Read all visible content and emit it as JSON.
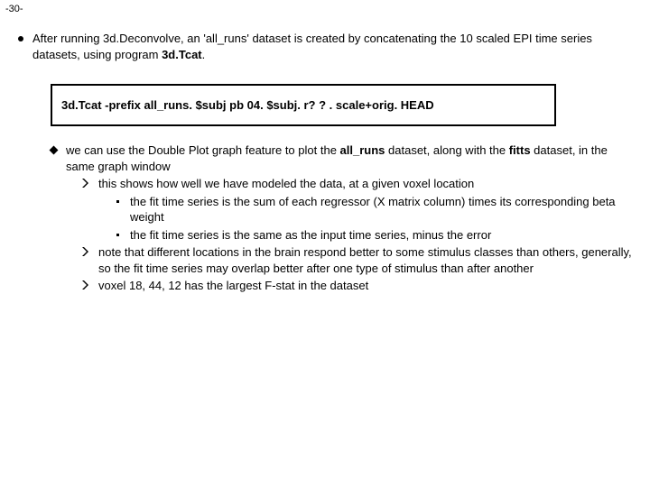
{
  "page_number": "-30-",
  "intro": {
    "pre": "After running 3d.Deconvolve, an 'all_runs' dataset is created by concatenating the 10 scaled EPI time series datasets, using program ",
    "program": "3d.Tcat",
    "post": "."
  },
  "command": "3d.Tcat -prefix all_runs. $subj pb 04. $subj. r? ? . scale+orig. HEAD",
  "diamond_item": {
    "p1": "we can use the Double Plot graph feature to plot the ",
    "b1": "all_runs",
    "p2": " dataset, along with the ",
    "b2": "fitts",
    "p3": " dataset, in the same graph window"
  },
  "chevrons": [
    {
      "text": "this shows how well we have modeled the data, at a given voxel location",
      "sub": [
        "the fit time series is the sum of each regressor (X matrix column) times its corresponding beta weight",
        "the fit time series is the same as the input time series, minus the error"
      ]
    },
    {
      "text": "note that different locations in the brain respond better to some stimulus classes than others, generally, so the fit time series may overlap better after one type of stimulus than after another",
      "sub": []
    },
    {
      "text": "voxel 18, 44, 12 has the largest F-stat in the dataset",
      "sub": []
    }
  ]
}
